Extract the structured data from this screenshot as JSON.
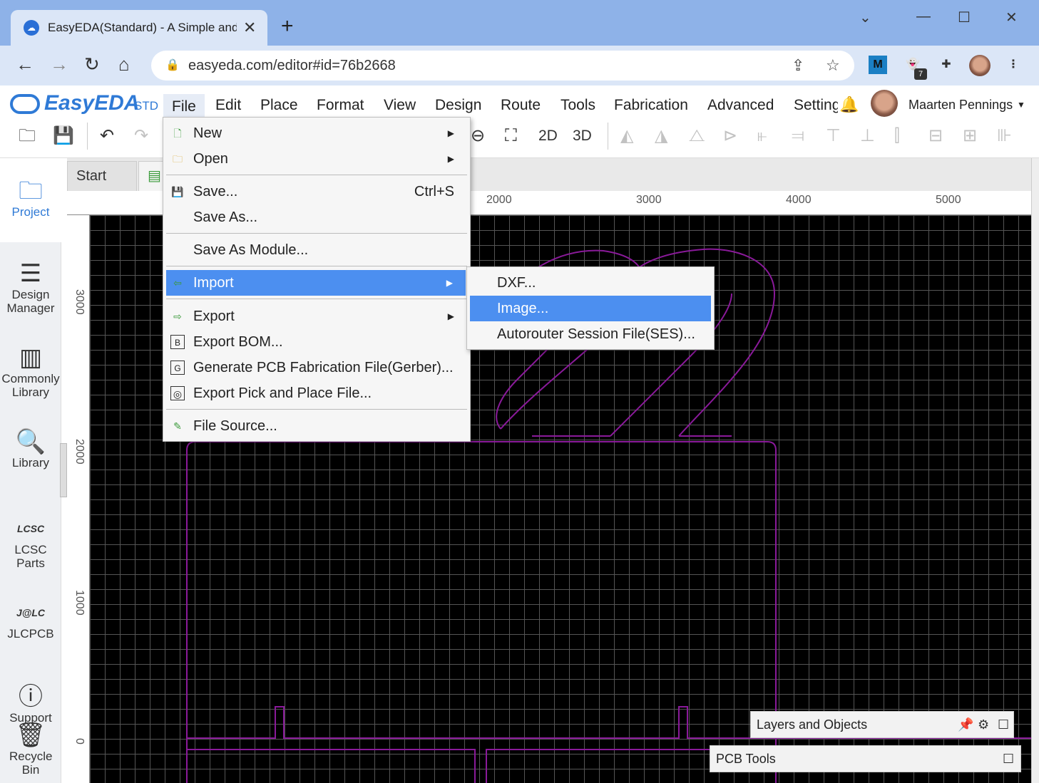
{
  "browser": {
    "tab_title": "EasyEDA(Standard) - A Simple and Powerful",
    "new_tab": "+",
    "url": "easyeda.com/editor#id=76b2668",
    "extension_badge": "7",
    "extension_m": "M"
  },
  "app": {
    "logo_text": "EasyEDA",
    "logo_suffix": "STD",
    "menu": [
      "File",
      "Edit",
      "Place",
      "Format",
      "View",
      "Design",
      "Route",
      "Tools",
      "Fabrication",
      "Advanced",
      "Setting"
    ],
    "user_name": "Maarten Pennings",
    "toolbar": {
      "mode_2d": "2D",
      "mode_3d": "3D"
    }
  },
  "left_panel": [
    {
      "label": "Project",
      "icon": "folder-icon"
    },
    {
      "label": "Design Manager",
      "icon": "list-icon"
    },
    {
      "label": "Commonly Library",
      "icon": "chip-icon"
    },
    {
      "label": "Library",
      "icon": "search-chip-icon"
    },
    {
      "label": "LCSC Parts",
      "icon": "lcsc-logo-icon"
    },
    {
      "label": "JLCPCB",
      "icon": "jlc-logo-icon"
    },
    {
      "label": "Support",
      "icon": "help-icon"
    },
    {
      "label": "Recycle Bin",
      "icon": "trash-icon"
    }
  ],
  "editor": {
    "tabs": [
      "Start"
    ],
    "ruler_top": [
      "2000",
      "3000",
      "4000",
      "5000"
    ],
    "ruler_left": [
      "3000",
      "2000",
      "1000",
      "0"
    ]
  },
  "file_menu": {
    "items": [
      {
        "label": "New",
        "icon": "new-file-icon",
        "submenu": true
      },
      {
        "label": "Open",
        "icon": "open-folder-icon",
        "submenu": true
      },
      {
        "label": "Save...",
        "icon": "save-icon",
        "shortcut": "Ctrl+S"
      },
      {
        "label": "Save As...",
        "icon": ""
      },
      {
        "label": "Save As Module...",
        "icon": ""
      },
      {
        "label": "Import",
        "icon": "import-icon",
        "submenu": true,
        "highlighted": true
      },
      {
        "label": "Export",
        "icon": "export-icon",
        "submenu": true
      },
      {
        "label": "Export BOM...",
        "icon": "bom-icon"
      },
      {
        "label": "Generate PCB Fabrication File(Gerber)...",
        "icon": "gerber-icon"
      },
      {
        "label": "Export Pick and Place File...",
        "icon": "pick-place-icon"
      },
      {
        "label": "File Source...",
        "icon": "pencil-icon"
      }
    ],
    "icon_glyphs": {
      "bom": "B",
      "gerber": "G"
    }
  },
  "import_submenu": [
    "DXF...",
    "Image...",
    "Autorouter Session File(SES)..."
  ],
  "panels": {
    "layers": "Layers and Objects",
    "pcb_tools": "PCB Tools"
  },
  "colors": {
    "accent": "#4c8ff0",
    "board_outline": "#8a1a9a",
    "canvas": "#000000"
  }
}
